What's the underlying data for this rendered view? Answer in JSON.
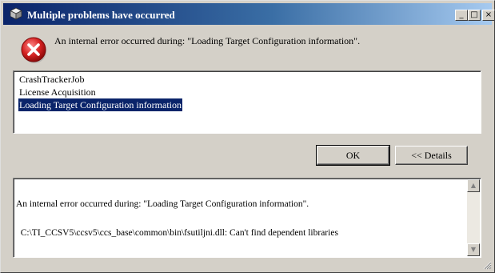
{
  "window": {
    "title": "Multiple problems have occurred",
    "icon": "ccs-app-icon",
    "controls": {
      "minimize": "_",
      "maximize": "□",
      "close": "×"
    }
  },
  "message": "An internal error occurred during: \"Loading Target Configuration information\".",
  "problems": [
    {
      "label": "CrashTrackerJob",
      "selected": false
    },
    {
      "label": "License Acquisition",
      "selected": false
    },
    {
      "label": "Loading Target Configuration information",
      "selected": true
    }
  ],
  "buttons": {
    "ok": "OK",
    "details": "<< Details"
  },
  "details": {
    "line1": "An internal error occurred during: \"Loading Target Configuration information\".",
    "line2": "  C:\\TI_CCSV5\\ccsv5\\ccs_base\\common\\bin\\fsutiljni.dll: Can't find dependent libraries"
  },
  "scrollbar": {
    "up": "▲",
    "down": "▼"
  },
  "colors": {
    "selection": "#0a246a",
    "title_start": "#0a246a",
    "title_end": "#a6caf0",
    "error_icon": "#d42020"
  }
}
